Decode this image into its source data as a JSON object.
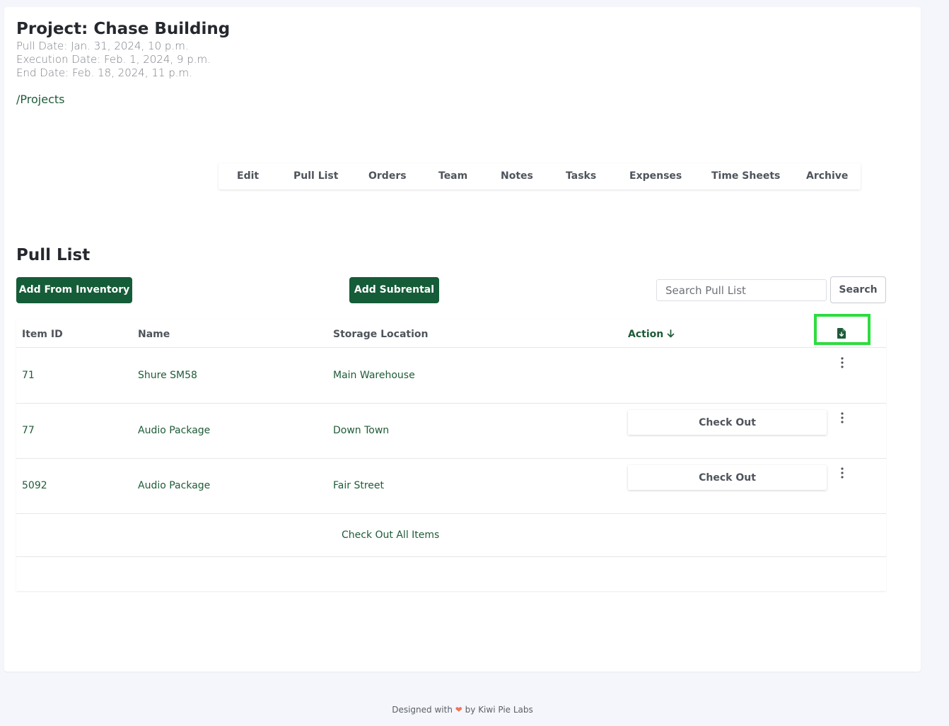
{
  "project": {
    "title": "Project: Chase Building",
    "pull_date": "Pull Date: Jan. 31, 2024, 10 p.m.",
    "execution_date": "Execution Date: Feb. 1, 2024, 9 p.m.",
    "end_date": "End Date: Feb. 18, 2024, 11 p.m."
  },
  "breadcrumb": {
    "label": "/Projects"
  },
  "tabs": [
    "Edit",
    "Pull List",
    "Orders",
    "Team",
    "Notes",
    "Tasks",
    "Expenses",
    "Time Sheets",
    "Archive"
  ],
  "section": {
    "title": "Pull List"
  },
  "toolbar": {
    "add_inventory_label": "Add From Inventory",
    "add_subrental_label": "Add Subrental",
    "search_placeholder": "Search Pull List",
    "search_label": "Search"
  },
  "table": {
    "headers": {
      "item_id": "Item ID",
      "name": "Name",
      "storage_location": "Storage Location",
      "action": "Action",
      "sort_icon": "arrow-down-icon",
      "export_icon": "file-download-icon"
    },
    "rows": [
      {
        "item_id": "71",
        "name": "Shure SM58",
        "location": "Main Warehouse",
        "action": ""
      },
      {
        "item_id": "77",
        "name": "Audio Package",
        "location": "Down Town",
        "action": "Check Out"
      },
      {
        "item_id": "5092",
        "name": "Audio Package",
        "location": "Fair Street",
        "action": "Check Out"
      }
    ],
    "row_menu_icon": "kebab-menu-icon",
    "check_out_all_label": "Check Out All Items"
  },
  "footer": {
    "prefix": "Designed with",
    "heart_icon": "heart-icon",
    "suffix": "by Kiwi Pie Labs"
  },
  "colors": {
    "brand_green": "#155c38",
    "link_green": "#1e5b37",
    "highlight": "#2edc3f",
    "heart": "#f0735a",
    "page_background": "#f5f6fb"
  }
}
